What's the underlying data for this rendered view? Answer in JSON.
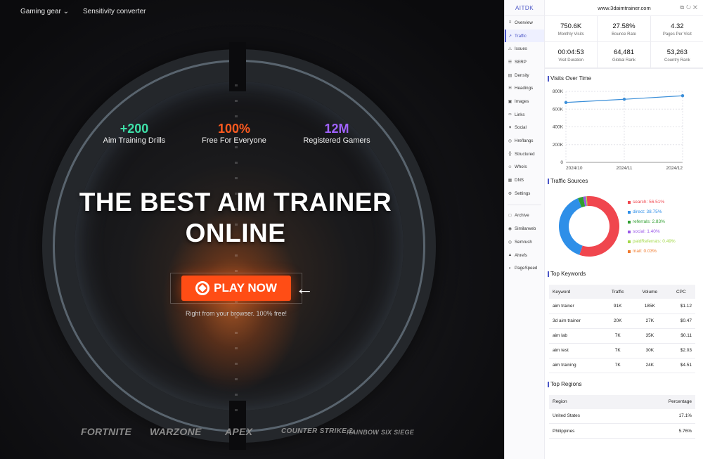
{
  "nav": {
    "gear": "Gaming gear",
    "converter": "Sensitivity converter"
  },
  "stats": [
    {
      "num": "+200",
      "label": "Aim Training Drills",
      "color": "#3ee0a8"
    },
    {
      "num": "100%",
      "label": "Free For Everyone",
      "color": "#ff5a1f"
    },
    {
      "num": "12M",
      "label": "Registered Gamers",
      "color": "#a062ff"
    }
  ],
  "hero": {
    "line1": "THE BEST AIM TRAINER",
    "line2": "ONLINE",
    "cta": "PLAY NOW",
    "sub": "Right from your browser. 100% free!"
  },
  "games": [
    "FORTNITE",
    "WARZONE",
    "APEX",
    "COUNTER STRIKE 2",
    "RAINBOW SIX SIEGE"
  ],
  "ext": {
    "brand": "AITDK",
    "domain": "www.3daimtrainer.com",
    "sidebar": [
      "Overview",
      "Traffic",
      "Issues",
      "SERP",
      "Density",
      "Headings",
      "Images",
      "Links",
      "Social",
      "Hreflangs",
      "Structured",
      "WhoIs",
      "DNS",
      "Settings"
    ],
    "sidebar_links": [
      "Archive",
      "Similarweb",
      "Semrush",
      "Ahrefs",
      "PageSpeed"
    ],
    "metrics": [
      {
        "value": "750.6K",
        "label": "Monthly Visits"
      },
      {
        "value": "27.58%",
        "label": "Bounce Rate"
      },
      {
        "value": "4.32",
        "label": "Pages Per Visit"
      },
      {
        "value": "00:04:53",
        "label": "Visit Duration"
      },
      {
        "value": "64,481",
        "label": "Global Rank"
      },
      {
        "value": "53,263",
        "label": "Country Rank"
      }
    ],
    "visits_title": "Visits Over Time",
    "sources_title": "Traffic Sources",
    "keywords_title": "Top Keywords",
    "regions_title": "Top Regions",
    "keywords_headers": [
      "Keyword",
      "Traffic",
      "Volume",
      "CPC"
    ],
    "keywords": [
      [
        "aim trainer",
        "91K",
        "185K",
        "$1.12"
      ],
      [
        "3d aim trainer",
        "20K",
        "27K",
        "$0.47"
      ],
      [
        "aim lab",
        "7K",
        "35K",
        "$0.11"
      ],
      [
        "aim test",
        "7K",
        "30K",
        "$2.03"
      ],
      [
        "aim training",
        "7K",
        "24K",
        "$4.51"
      ]
    ],
    "regions_headers": [
      "Region",
      "Percentage"
    ],
    "regions": [
      [
        "United States",
        "17.1%"
      ],
      [
        "Philippines",
        "5.76%"
      ]
    ]
  },
  "chart_data": [
    {
      "type": "line",
      "title": "Visits Over Time",
      "x": [
        "2024/10",
        "2024/11",
        "2024/12"
      ],
      "values": [
        675000,
        711000,
        750600
      ],
      "ylim": [
        0,
        800000
      ],
      "yticks": [
        "0",
        "200K",
        "400K",
        "600K",
        "800K"
      ],
      "color": "#3b8fd9"
    },
    {
      "type": "pie",
      "title": "Traffic Sources",
      "labels": [
        "search: 56.51%",
        "direct: 38.75%",
        "referrals: 2.83%",
        "social: 1.40%",
        "paidReferrals: 0.49%",
        "mail: 0.03%"
      ],
      "values": [
        56.51,
        38.75,
        2.83,
        1.4,
        0.49,
        0.03
      ],
      "colors": [
        "#f0464e",
        "#2e8fe8",
        "#2f9e2f",
        "#9b59e8",
        "#a3d94a",
        "#f07a2e"
      ]
    }
  ]
}
